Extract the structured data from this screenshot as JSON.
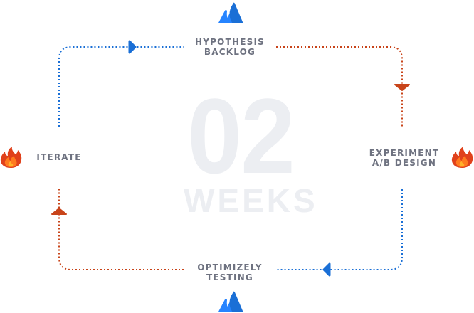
{
  "cycle": {
    "duration_number": "02",
    "duration_unit": "WEEKS",
    "stages": {
      "top": {
        "line1": "HYPOTHESIS",
        "line2": "BACKLOG",
        "icon": "atlassian-logo-icon"
      },
      "right": {
        "line1": "EXPERIMENT",
        "line2": "A/B DESIGN",
        "icon": "flame-icon"
      },
      "bottom": {
        "line1": "OPTIMIZELY",
        "line2": "TESTING",
        "icon": "atlassian-logo-icon"
      },
      "left": {
        "line1": "ITERATE",
        "icon": "flame-icon"
      }
    }
  },
  "colors": {
    "blue": "#1a6fd6",
    "blue_light": "#2684ff",
    "orange": "#c8441a",
    "flame_yellow": "#ffb12a",
    "label_gray": "#6e7280",
    "watermark_gray": "#eceef2"
  }
}
